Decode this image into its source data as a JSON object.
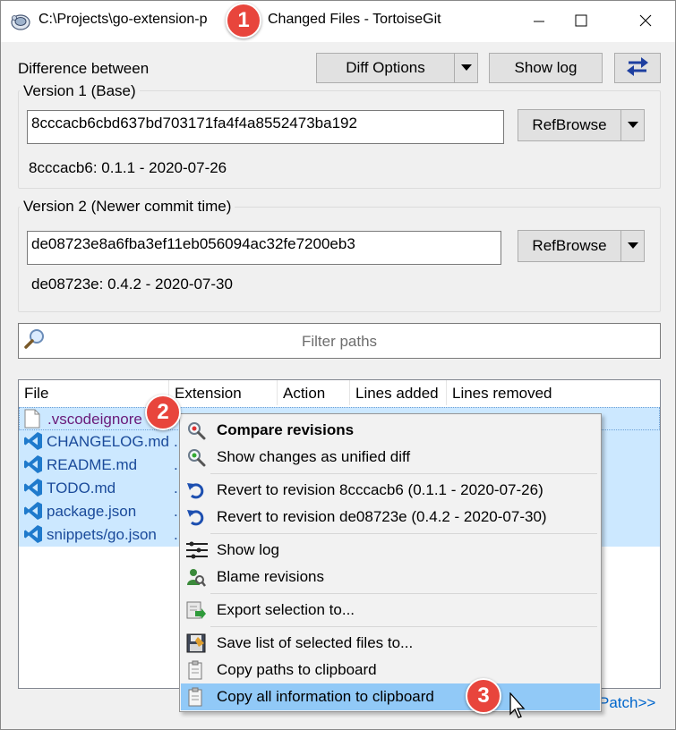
{
  "window": {
    "title_part1": "C:\\Projects\\go-extension-p",
    "title_part2": "Changed Files - TortoiseGit"
  },
  "header": {
    "difference_between": "Difference between",
    "diff_options_label": "Diff Options",
    "show_log_label": "Show log"
  },
  "version1": {
    "group_label": "Version 1 (Base)",
    "hash": "8cccacb6cbd637bd703171fa4f4a8552473ba192",
    "summary": "8cccacb6: 0.1.1 - 2020-07-26",
    "refbrowse_label": "RefBrowse"
  },
  "version2": {
    "group_label": "Version 2 (Newer commit time)",
    "hash": "de08723e8a6fba3ef11eb056094ac32fe7200eb3",
    "summary": "de08723e: 0.4.2 - 2020-07-30",
    "refbrowse_label": "RefBrowse"
  },
  "filter": {
    "placeholder": "Filter paths"
  },
  "file_list": {
    "columns": [
      "File",
      "Extension",
      "Action",
      "Lines added",
      "Lines removed"
    ],
    "rows": [
      {
        "name": ".vscodeignore",
        "icon": "file-icon"
      },
      {
        "name": "CHANGELOG.md",
        "icon": "vscode-icon"
      },
      {
        "name": "README.md",
        "icon": "vscode-icon"
      },
      {
        "name": "TODO.md",
        "icon": "vscode-icon"
      },
      {
        "name": "package.json",
        "icon": "vscode-icon"
      },
      {
        "name": "snippets/go.json",
        "icon": "vscode-icon"
      }
    ]
  },
  "context_menu": {
    "items": [
      {
        "label": "Compare revisions",
        "icon": "magnifier-icon"
      },
      {
        "label": "Show changes as unified diff",
        "icon": "magnifier-icon"
      },
      {
        "label": "Revert to revision 8cccacb6 (0.1.1 - 2020-07-26)",
        "icon": "revert-icon"
      },
      {
        "label": "Revert to revision de08723e (0.4.2 - 2020-07-30)",
        "icon": "revert-icon"
      },
      {
        "label": "Show log",
        "icon": "log-icon"
      },
      {
        "label": "Blame revisions",
        "icon": "blame-icon"
      },
      {
        "label": "Export selection to...",
        "icon": "export-icon"
      },
      {
        "label": "Save list of selected files to...",
        "icon": "save-icon"
      },
      {
        "label": "Copy paths to clipboard",
        "icon": "clipboard-icon"
      },
      {
        "label": "Copy all information to clipboard",
        "icon": "clipboard-icon"
      }
    ]
  },
  "patch_link": "Patch>>",
  "badges": [
    "1",
    "2",
    "3"
  ],
  "colors": {
    "badge": "#e8453c",
    "selection": "#cce8ff",
    "menu_highlight": "#91c9f7",
    "link": "#0066cc",
    "vscode_blue": "#1f7acc"
  }
}
